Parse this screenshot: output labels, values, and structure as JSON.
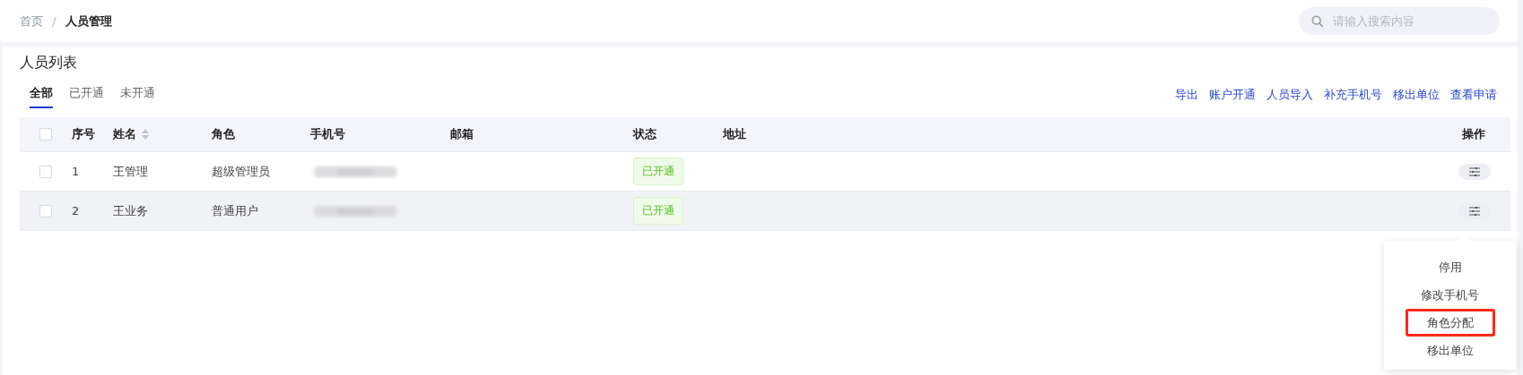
{
  "breadcrumb_separator": "/",
  "breadcrumb": [
    {
      "label": "首页",
      "current": false
    },
    {
      "label": "人员管理",
      "current": true
    }
  ],
  "search": {
    "placeholder": "请输入搜索内容"
  },
  "panel": {
    "title": "人员列表"
  },
  "tabs": [
    {
      "label": "全部",
      "selected": true
    },
    {
      "label": "已开通",
      "selected": false
    },
    {
      "label": "未开通",
      "selected": false
    }
  ],
  "actions": [
    "导出",
    "账户开通",
    "人员导入",
    "补充手机号",
    "移出单位",
    "查看申请"
  ],
  "table": {
    "columns": [
      {
        "label": "序号",
        "sortable": false
      },
      {
        "label": "姓名",
        "sortable": true
      },
      {
        "label": "角色",
        "sortable": false
      },
      {
        "label": "手机号",
        "sortable": false
      },
      {
        "label": "邮箱",
        "sortable": false
      },
      {
        "label": "状态",
        "sortable": false
      },
      {
        "label": "地址",
        "sortable": false
      },
      {
        "label": "操作",
        "sortable": false
      }
    ],
    "header_checked": false,
    "rows": [
      {
        "checked": false,
        "hovered": false,
        "index": "1",
        "name": "王管理",
        "role": "超级管理员",
        "status": "已开通"
      },
      {
        "checked": false,
        "hovered": true,
        "index": "2",
        "name": "王业务",
        "role": "普通用户",
        "status": "已开通"
      }
    ]
  },
  "menu": {
    "items": [
      {
        "label": "停用",
        "highlighted": false
      },
      {
        "label": "修改手机号",
        "highlighted": false
      },
      {
        "label": "角色分配",
        "highlighted": true
      },
      {
        "label": "移出单位",
        "highlighted": false
      }
    ]
  }
}
